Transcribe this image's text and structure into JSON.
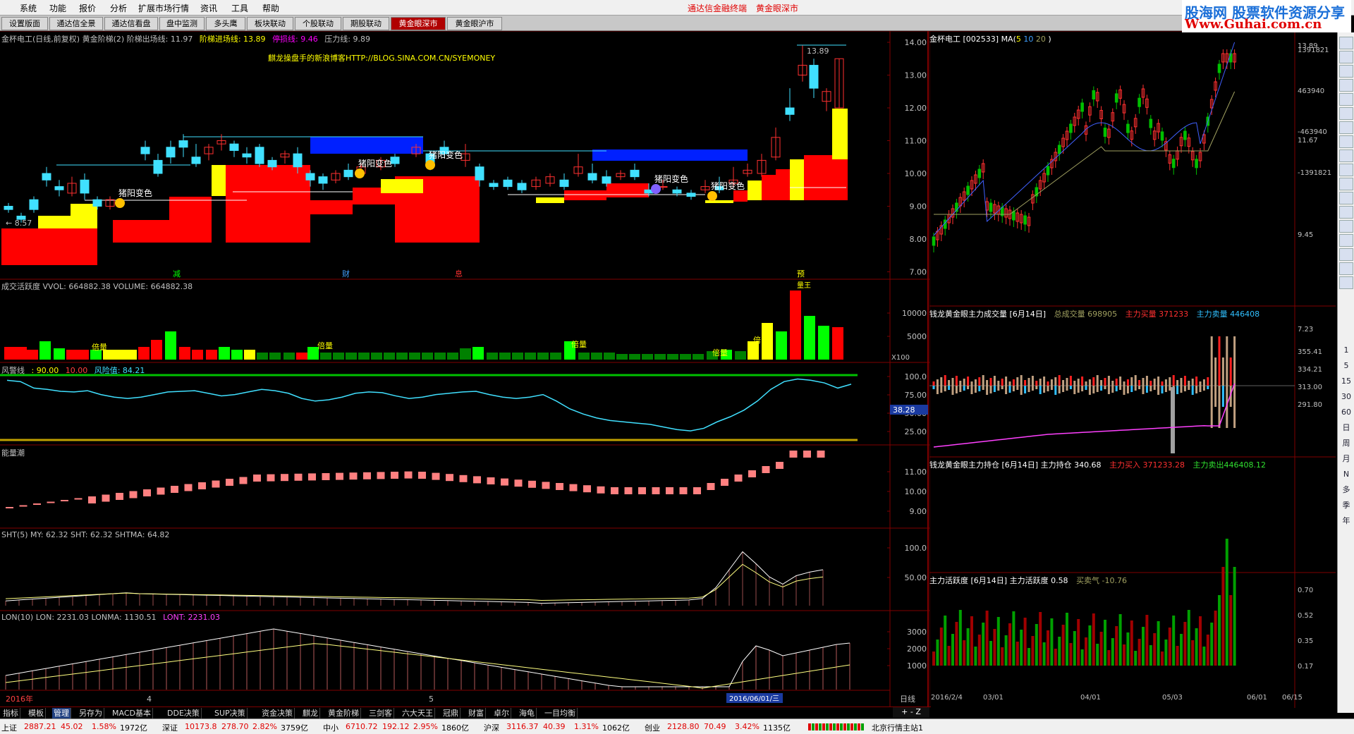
{
  "menubar": {
    "items": [
      "系统",
      "功能",
      "报价",
      "分析",
      "扩展市场行情",
      "资讯",
      "工具",
      "帮助"
    ],
    "center1": "通达信金融终端",
    "center2": "黄金眼深市"
  },
  "logo": {
    "line1": "股海网 股票软件资源分享",
    "line2": "Www.Guhai.com.cn"
  },
  "tabs": [
    "设置版面",
    "通达信全景",
    "通达信看盘",
    "盘中监测",
    "多头鹰",
    "板块联动",
    "个股联动",
    "期股联动",
    "黄金眼深市",
    "黄金眼沪市"
  ],
  "active_tab": "黄金眼深市",
  "main": {
    "title_parts": [
      {
        "t": "金杯电工(日线,前复权) 黄金阶梯(2) 阶梯出场线: 11.97",
        "c": "#c0c0c0"
      },
      {
        "t": "阶梯进场线: 13.89",
        "c": "#ffff00"
      },
      {
        "t": "停损线: 9.46",
        "c": "#ff00ff"
      },
      {
        "t": "压力线: 9.89",
        "c": "#c0c0c0"
      }
    ],
    "blog": "麒龙操盘手的新浪博客HTTP://BLOG.SINA.COM.CN/SYEMONEY",
    "ylabels": [
      "14.00",
      "13.00",
      "12.00",
      "11.00",
      "10.00",
      "9.00",
      "8.00",
      "7.00"
    ],
    "markers": [
      "猪阳变色",
      "猪阳变色",
      "猪阳变色",
      "猪阳变色",
      "猪阳变色"
    ],
    "left_price": "8.57",
    "high_price": "13.89",
    "events": [
      "减",
      "财",
      "息",
      "预"
    ]
  },
  "vol": {
    "title": "成交活跃度 VVOL: 664882.38  VOLUME: 664882.38",
    "ylabels": [
      "10000",
      "5000"
    ],
    "unit": "X100",
    "tags": [
      "倍量",
      "倍量",
      "倍量",
      "倍量",
      "倍"
    ],
    "tag_high": "量王"
  },
  "risk": {
    "title_a": "风警线",
    "v1": ": 90.00",
    "v2": "10.00",
    "title_b": "风险值: 84.21",
    "ylabels": [
      "100.0",
      "75.00",
      "50.00",
      "25.00"
    ],
    "cur": "38.28"
  },
  "energy": {
    "title": "能量潮",
    "ylabels": [
      "11.00",
      "10.00",
      "9.00"
    ]
  },
  "sht": {
    "title": "SHT(5)  MY: 62.32  SHT: 62.32  SHTMA: 64.82",
    "ylabels": [
      "100.0",
      "50.00"
    ]
  },
  "lon": {
    "title_a": "LON(10)  LON: 2231.03  LONMA: 1130.51",
    "title_b": "LONT: 2231.03",
    "ylabels": [
      "3000",
      "2000",
      "1000"
    ]
  },
  "dates": {
    "year": "2016年",
    "m4": "4",
    "m5": "5",
    "cur": "2016/06/01/三",
    "period": "日线"
  },
  "right": {
    "k_title": "金杯电工 [002533] MA(",
    "ma": [
      "5",
      "10",
      "20"
    ],
    "k_title_end": ")",
    "k_ylabels": [
      "13.89",
      "11.67",
      "9.45",
      "7.23"
    ],
    "v_title": "钱龙黄金眼主力成交量 [6月14日]",
    "v_total": "总成交量 698905",
    "v_buy": "主力买量 371233",
    "v_sell": "主力卖量 446408",
    "v_ylabels": [
      "1391821",
      "463940",
      "-463940",
      "-1391821"
    ],
    "p_title": "钱龙黄金眼主力持仓 [6月14日]  主力持仓 340.68",
    "p_buy": "主力买入 371233.28",
    "p_sell": "主力卖出446408.12",
    "p_ylabels": [
      "355.41",
      "334.21",
      "313.00",
      "291.80"
    ],
    "a_title": "主力活跃度 [6月14日]  主力活跃度 0.58",
    "a_qi": "买卖气 -10.76",
    "a_ylabels": [
      "0.70",
      "0.52",
      "0.35",
      "0.17"
    ],
    "dates": [
      "2016/2/4",
      "03/01",
      "04/01",
      "05/03",
      "06/01",
      "06/15"
    ]
  },
  "rtool": [
    "日",
    "周",
    "月",
    "N",
    "多",
    "季",
    "年",
    "1",
    "5",
    "15",
    "30",
    "60"
  ],
  "btabs": [
    "指标",
    "模板",
    "管理",
    "另存为",
    "MACD基本",
    "DDE决策",
    "SUP决策",
    "资金决策",
    "麒龙",
    "黄金阶梯",
    "三剑客",
    "六大天王",
    "冠鼎",
    "财富",
    "卓尔",
    "海龟",
    "一目均衡"
  ],
  "btab_active": "管理",
  "status": [
    {
      "n": "上证",
      "v": "2887.21",
      "c": "45.02",
      "p": "1.58%",
      "a": "1972亿"
    },
    {
      "n": "深证",
      "v": "10173.8",
      "c": "278.70",
      "p": "2.82%",
      "a": "3759亿"
    },
    {
      "n": "中小",
      "v": "6710.72",
      "c": "192.12",
      "p": "2.95%",
      "a": "1860亿"
    },
    {
      "n": "沪深",
      "v": "3116.37",
      "c": "40.39",
      "p": "1.31%",
      "a": "1062亿"
    },
    {
      "n": "创业",
      "v": "2128.80",
      "c": "70.49",
      "p": "3.42%",
      "a": "1135亿"
    }
  ],
  "status_site": "北京行情主站1"
}
